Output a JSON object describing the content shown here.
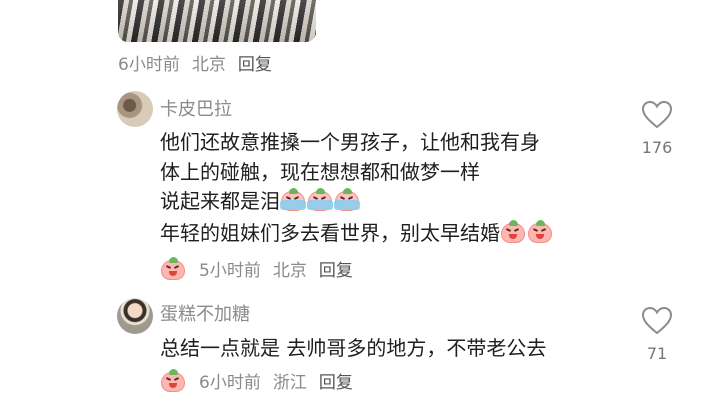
{
  "comment0": {
    "time": "6小时前",
    "location": "北京",
    "reply_label": "回复"
  },
  "comment1": {
    "username": "卡皮巴拉",
    "lines": [
      "他们还故意推搡一个男孩子，让他和我有身",
      "体上的碰触，现在想想都和做梦一样",
      "说起来都是泪",
      "年轻的姐妹们多去看世界，别太早结婚"
    ],
    "emoji_after_line3": [
      "cry-peach-emoji",
      "cry-peach-emoji",
      "cry-peach-emoji"
    ],
    "emoji_after_line4": [
      "laugh-peach-emoji",
      "laugh-peach-emoji"
    ],
    "time": "5小时前",
    "location": "北京",
    "reply_label": "回复",
    "likes": "176"
  },
  "comment2": {
    "username": "蛋糕不加糖",
    "lines": [
      "总结一点就是 去帅哥多的地方，不带老公去"
    ],
    "time": "6小时前",
    "location": "浙江",
    "reply_label": "回复",
    "likes": "71"
  },
  "colors": {
    "text": "#1f1f1f",
    "meta": "#8a8a8a",
    "heart_outline": "#8c8c8c"
  }
}
